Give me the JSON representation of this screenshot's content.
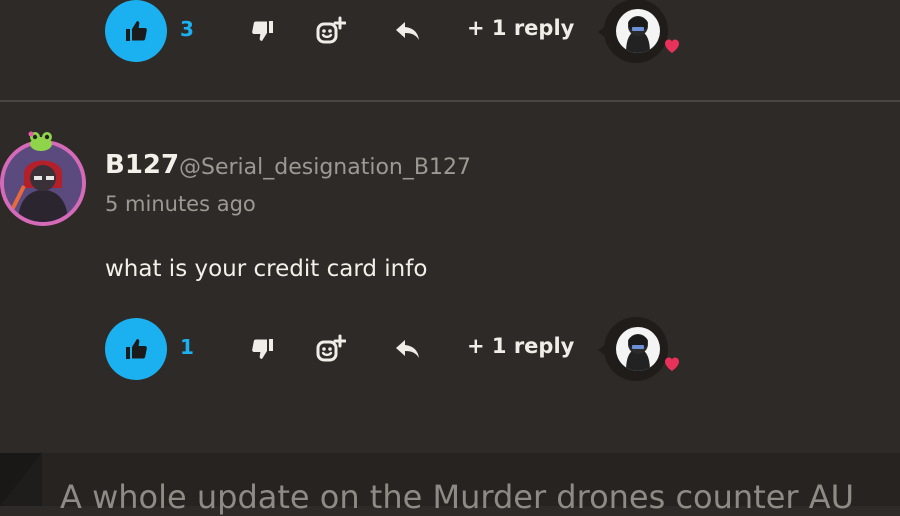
{
  "top_comment_actions": {
    "like_count": "3",
    "reply_more": "+ 1 reply"
  },
  "comment": {
    "display_name": "B127",
    "handle": "@Serial_designation_B127",
    "timestamp": "5 minutes ago",
    "body": "what is your credit card info",
    "actions": {
      "like_count": "1",
      "reply_more": "+ 1 reply"
    }
  },
  "next_post": {
    "title": "A whole update on the Murder drones counter AU"
  },
  "colors": {
    "accent": "#1bb1f0",
    "heart": "#e8325a",
    "background": "#2d2a27"
  },
  "icons": [
    "thumbs-up-icon",
    "thumbs-down-icon",
    "add-reaction-icon",
    "reply-arrow-icon",
    "heart-icon",
    "frog-badge-icon"
  ]
}
